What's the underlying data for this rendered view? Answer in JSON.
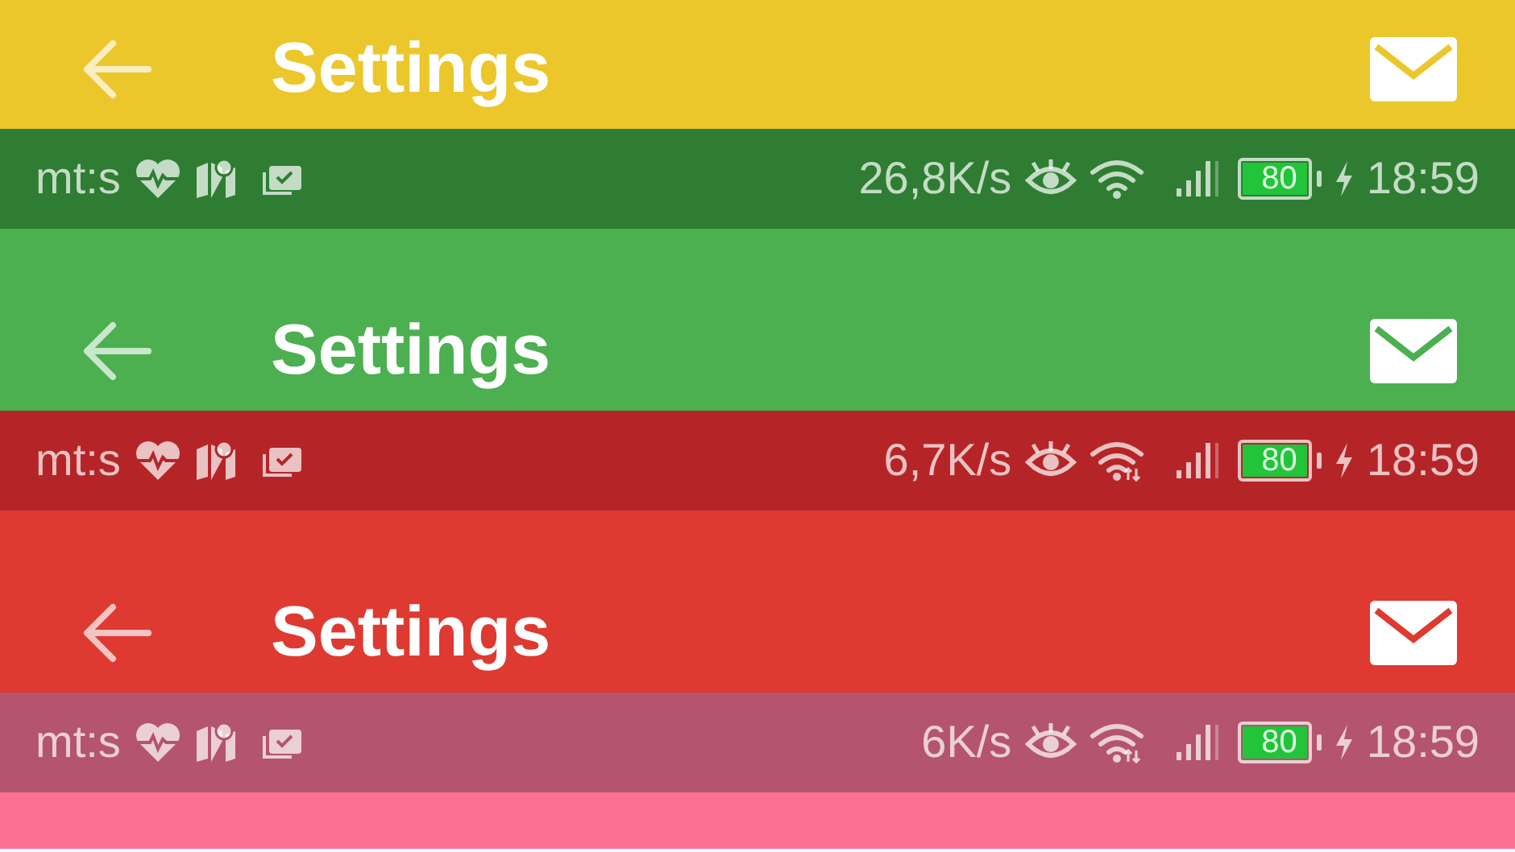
{
  "bands": [
    {
      "kind": "app_bar",
      "color": "#ecc72b",
      "title": "Settings"
    },
    {
      "kind": "status_bar",
      "color": "#2e7d32",
      "carrier": "mt:s",
      "speed": "26,8K/s",
      "wifi_activity": false,
      "battery": "80",
      "time": "18:59"
    },
    {
      "kind": "app_bar",
      "color": "#4caf50",
      "title": "Settings"
    },
    {
      "kind": "status_bar",
      "color": "#b52528",
      "carrier": "mt:s",
      "speed": "6,7K/s",
      "wifi_activity": true,
      "battery": "80",
      "time": "18:59"
    },
    {
      "kind": "app_bar",
      "color": "#de3a31",
      "title": "Settings"
    },
    {
      "kind": "status_bar",
      "color": "#b5546e",
      "carrier": "mt:s",
      "speed": "6K/s",
      "wifi_activity": true,
      "battery": "80",
      "time": "18:59"
    },
    {
      "kind": "app_bar",
      "color": "#fb7193"
    }
  ]
}
